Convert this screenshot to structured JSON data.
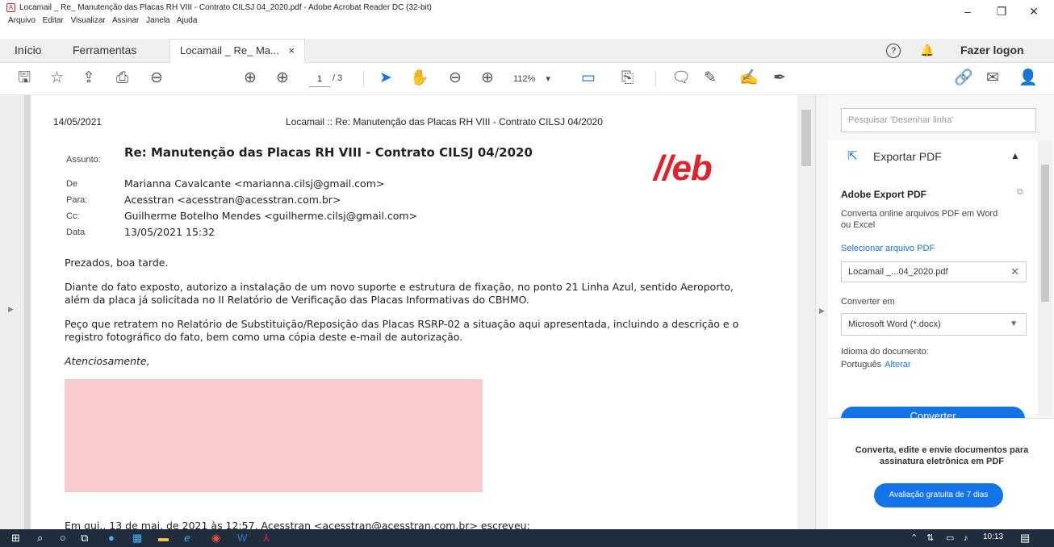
{
  "window": {
    "title": "Locamail _ Re_ Manutenção das Placas RH VIII - Contrato CILSJ 04_2020.pdf - Adobe Acrobat Reader DC (32-bit)",
    "menu": [
      "Arquivo",
      "Editar",
      "Visualizar",
      "Assinar",
      "Janela",
      "Ajuda"
    ],
    "controls": {
      "minimize": "–",
      "maximize": "❐",
      "close": "✕"
    }
  },
  "tabs": {
    "home": "Início",
    "tools": "Ferramentas",
    "doc": "Locamail _ Re_ Ma...",
    "doc_close": "×",
    "help": "?",
    "signin": "Fazer logon"
  },
  "toolbar": {
    "page_current": "1",
    "page_total": "/ 3",
    "zoom": "112%",
    "zoom_arrow": "▾"
  },
  "document": {
    "header_date": "14/05/2021",
    "header_title": "Locamail :: Re: Manutenção das Placas RH VIII - Contrato CILSJ 04/2020",
    "brand": "//eb",
    "subject_label": "Assunto:",
    "subject": "Re: Manutenção das Placas RH VIII - Contrato CILSJ 04/2020",
    "from_label": "De",
    "from": "Marianna Cavalcante <marianna.cilsj@gmail.com>",
    "to_label": "Para:",
    "to": "Acesstran <acesstran@acesstran.com.br>",
    "cc_label": "Cc:",
    "cc": "Guilherme Botelho Mendes <guilherme.cilsj@gmail.com>",
    "date_label": "Data",
    "date": "13/05/2021 15:32",
    "greeting": "Prezados, boa tarde.",
    "para1": "Diante do fato exposto, autorizo a instalação de um novo suporte e estrutura de fixação, no ponto 21 Linha Azul, sentido Aeroporto, além da placa já solicitada no II Relatório de Verificação das Placas Informativas do CBHMO.",
    "para2": "Peço que retratem no Relatório de Substituição/Reposição das Placas RSRP-02 a situação aqui apresentada, incluindo a descrição e o registro fotográfico do fato, bem como uma cópia deste e-mail de autorização.",
    "closing": "Atenciosamente,",
    "quoted": "Em qui., 13 de mai. de 2021 às 12:57, Acesstran <acesstran@acesstran.com.br> escreveu:"
  },
  "right_panel": {
    "search_placeholder": "Pesquisar 'Desenhar linha'",
    "export_header": "Exportar PDF",
    "export_title": "Adobe Export PDF",
    "export_desc": "Converta online arquivos PDF em Word ou Excel",
    "select_link": "Selecionar arquivo PDF",
    "file_name": "Locamail _...04_2020.pdf",
    "convert_label": "Converter em",
    "convert_value": "Microsoft Word (*.docx)",
    "lang_label": "Idioma do documento:",
    "lang_value": "Português",
    "lang_change": "Alterar",
    "convert_button": "Converter",
    "promo_text": "Converta, edite e envie documentos para assinatura eletrônica em PDF",
    "trial_button": "Avaliação gratuita de 7 dias"
  },
  "taskbar": {
    "time": "10:13"
  },
  "colors": {
    "accent": "#1473e6",
    "brand_red": "#e0232a",
    "redacted": "#f8cccc"
  }
}
